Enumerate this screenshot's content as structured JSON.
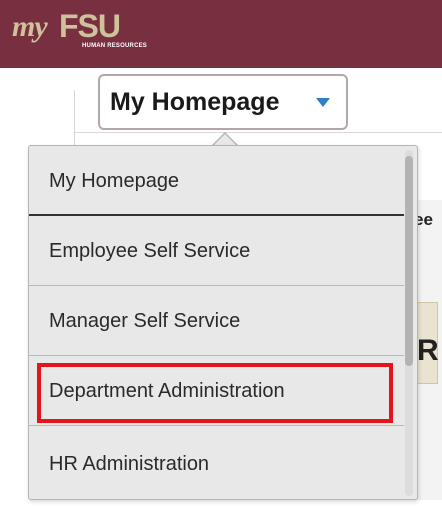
{
  "header": {
    "brand_prefix": "my",
    "brand_name": "FSU",
    "brand_subtitle": "HUMAN RESOURCES",
    "background_color": "#782f40",
    "brand_color": "#cec19b"
  },
  "homepage_selector": {
    "label": "My Homepage",
    "icon": "caret-down-icon",
    "caret_color": "#2d7fc7"
  },
  "dropdown": {
    "items": [
      {
        "label": "My Homepage"
      },
      {
        "label": "Employee Self Service"
      },
      {
        "label": "Manager Self Service"
      },
      {
        "label": "Department Administration",
        "highlighted": true
      },
      {
        "label": "HR Administration"
      }
    ],
    "highlight_color": "#e5141c"
  },
  "background_peek": {
    "text": "ee",
    "tile_text": "R"
  }
}
